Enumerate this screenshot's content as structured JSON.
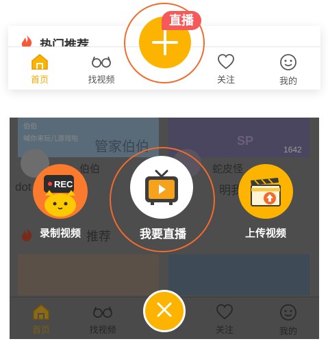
{
  "top": {
    "section_title": "热门推荐",
    "live_badge": "直播",
    "tabs": [
      {
        "label": "首页",
        "icon": "home-icon",
        "active": true
      },
      {
        "label": "找视频",
        "icon": "glasses-icon",
        "active": false
      },
      {
        "label": "关注",
        "icon": "heart-icon",
        "active": false
      },
      {
        "label": "我的",
        "icon": "face-icon",
        "active": false
      }
    ]
  },
  "overlay": {
    "actions": [
      {
        "label": "录制视频",
        "icon": "rec-cat-icon"
      },
      {
        "label": "我要直播",
        "icon": "tv-play-icon"
      },
      {
        "label": "上传视频",
        "icon": "clapper-upload-icon"
      }
    ],
    "rec_text": "REC",
    "close_icon": "close-icon"
  },
  "background": {
    "thumb1_caption": "管家伯伯",
    "thumb1_small1": "伯伯",
    "thumb1_small2": "喊你来玩儿游戏啦",
    "thumb2_caption": "SP",
    "thumb2_count": "1642",
    "row_left_name": "伯伯",
    "row_left_title": "dot",
    "row_right_name": "蛇皮怪",
    "row_right_title": "明我",
    "section_title": "推荐",
    "tabs": [
      {
        "label": "首页",
        "icon": "home-icon",
        "active": true
      },
      {
        "label": "找视频",
        "icon": "glasses-icon",
        "active": false
      },
      {
        "label": "关注",
        "icon": "heart-icon",
        "active": false
      },
      {
        "label": "我的",
        "icon": "face-icon",
        "active": false
      }
    ]
  },
  "colors": {
    "accent": "#fdb400",
    "ring": "#f36b2c",
    "badge": "#f45a5a",
    "rec": "#fb7a2e"
  }
}
